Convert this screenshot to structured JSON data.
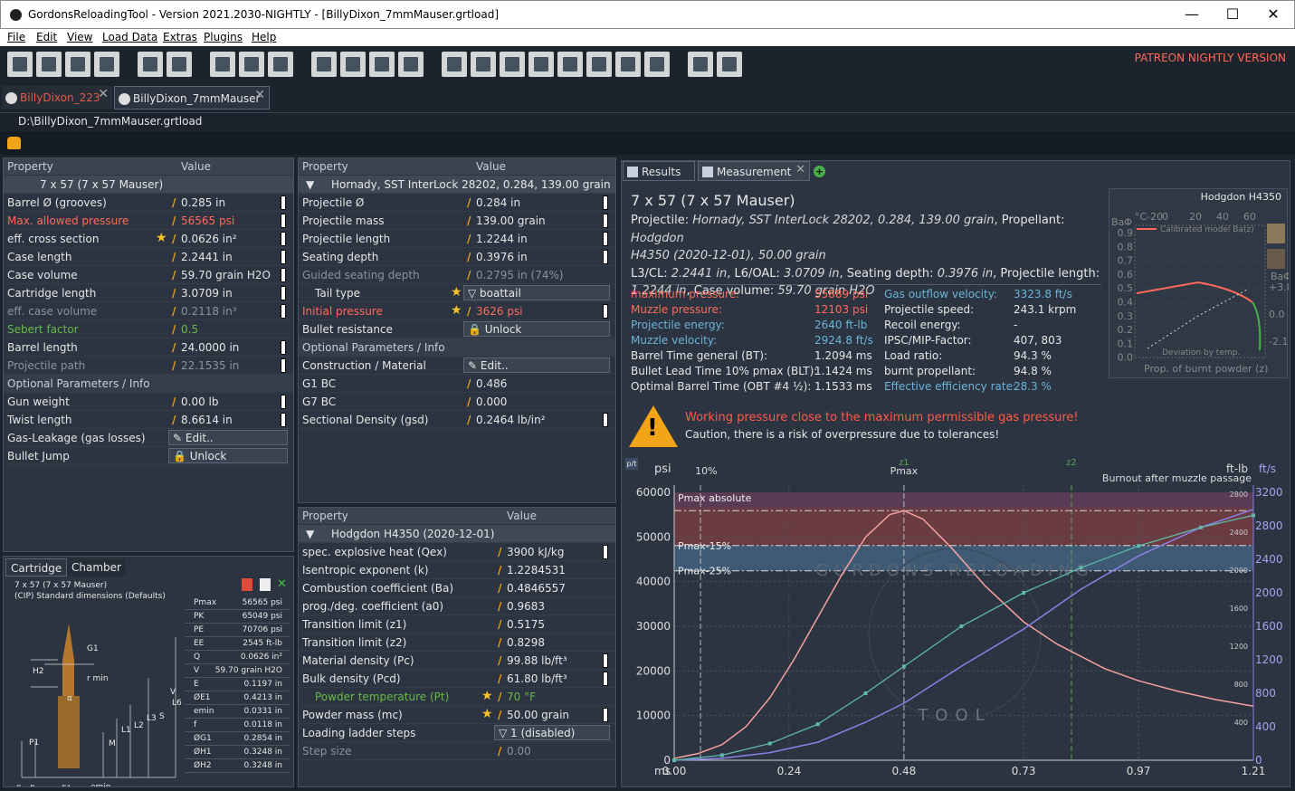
{
  "window": {
    "title": "GordonsReloadingTool - Version 2021.2030-NIGHTLY - [BillyDixon_7mmMauser.grtload]",
    "minimize": "—",
    "maximize": "☐",
    "close": "✕"
  },
  "menu": [
    "File",
    "Edit",
    "View",
    "Load Data",
    "Extras",
    "Plugins",
    "Help"
  ],
  "patreon": "PATREON NIGHTLY VERSION",
  "doc_tabs": [
    {
      "label": "BillyDixon_223"
    },
    {
      "label": "BillyDixon_7mmMauser"
    }
  ],
  "path": "D:\\BillyDixon_7mmMauser.grtload",
  "cartridge_panel": {
    "h_prop": "Property",
    "h_val": "Value",
    "group": "7 x 57 (7 x 57 Mauser)",
    "rows": [
      {
        "n": "Barrel Ø (grooves)",
        "v": "0.285 in"
      },
      {
        "n": "Max. allowed pressure",
        "v": "56565 psi"
      },
      {
        "n": "eff. cross section",
        "v": "0.0626 in²"
      },
      {
        "n": "Case length",
        "v": "2.2441 in"
      },
      {
        "n": "Case volume",
        "v": "59.70 grain H2O"
      },
      {
        "n": "Cartridge length",
        "v": "3.0709 in"
      },
      {
        "n": "eff. case volume",
        "v": "0.2118 in³"
      },
      {
        "n": "Sebert factor",
        "v": "0.5"
      },
      {
        "n": "Barrel length",
        "v": "24.0000 in"
      },
      {
        "n": "Projectile path",
        "v": "22.1535 in"
      }
    ],
    "opt": "Optional Parameters / Info",
    "rows2": [
      {
        "n": "Gun weight",
        "v": "0.00 lb"
      },
      {
        "n": "Twist length",
        "v": "8.6614 in"
      },
      {
        "n": "Gas-Leakage (gas losses)",
        "v": "Edit.."
      },
      {
        "n": "Bullet Jump",
        "v": "Unlock"
      }
    ]
  },
  "projectile_panel": {
    "h_prop": "Property",
    "h_val": "Value",
    "group": "Hornady, SST InterLock 28202, 0.284, 139.00 grain",
    "rows": [
      {
        "n": "Projectile Ø",
        "v": "0.284 in"
      },
      {
        "n": "Projectile mass",
        "v": "139.00 grain"
      },
      {
        "n": "Projectile length",
        "v": "1.2244 in"
      },
      {
        "n": "Seating depth",
        "v": "0.3976 in"
      },
      {
        "n": "Guided seating depth",
        "v": "0.2795 in (74%)"
      },
      {
        "n": "Tail type",
        "v": "boattail"
      },
      {
        "n": "Initial pressure",
        "v": "3626 psi"
      },
      {
        "n": "Bullet resistance",
        "v": "Unlock"
      }
    ],
    "opt": "Optional Parameters / Info",
    "rows2": [
      {
        "n": "Construction / Material",
        "v": "Edit.."
      },
      {
        "n": "G1 BC",
        "v": "0.486"
      },
      {
        "n": "G7 BC",
        "v": "0.000"
      },
      {
        "n": "Sectional Density (gsd)",
        "v": "0.2464 lb/in²"
      }
    ]
  },
  "powder_panel": {
    "h_prop": "Property",
    "h_val": "Value",
    "group": "Hodgdon H4350 (2020-12-01)",
    "rows": [
      {
        "n": "spec. explosive heat (Qex)",
        "v": "3900 kJ/kg"
      },
      {
        "n": "Isentropic exponent (k)",
        "v": "1.2284531"
      },
      {
        "n": "Combustion coefficient (Ba)",
        "v": "0.4846557"
      },
      {
        "n": "prog./deg. coefficient (a0)",
        "v": "0.9683"
      },
      {
        "n": "Transition limit (z1)",
        "v": "0.5175"
      },
      {
        "n": "Transition limit (z2)",
        "v": "0.8298"
      },
      {
        "n": "Material density (Pc)",
        "v": "99.88 lb/ft³"
      },
      {
        "n": "Bulk density (Pcd)",
        "v": "61.80 lb/ft³"
      },
      {
        "n": "Powder temperature (Pt)",
        "v": "70 °F"
      },
      {
        "n": "Powder mass (mc)",
        "v": "50.00 grain"
      },
      {
        "n": "Loading ladder steps",
        "v": "1 (disabled)"
      },
      {
        "n": "Step size",
        "v": "0.00"
      }
    ]
  },
  "cart_tabs": [
    "Cartridge",
    "Chamber"
  ],
  "cart_caption": [
    "7 x 57 (7 x 57 Mauser)",
    "(CIP) Standard dimensions (Defaults)"
  ],
  "cart_table": [
    [
      "Pmax",
      "56565 psi"
    ],
    [
      "PK",
      "65049 psi"
    ],
    [
      "PE",
      "70706 psi"
    ],
    [
      "EE",
      "2545 ft-lb"
    ],
    [
      "Q",
      "0.0626 in²"
    ],
    [
      "V",
      "59.70 grain H2O"
    ],
    [
      "E",
      "0.1197 in"
    ],
    [
      "ØE1",
      "0.4213 in"
    ],
    [
      "emin",
      "0.0331 in"
    ],
    [
      "f",
      "0.0118 in"
    ],
    [
      "ØG1",
      "0.2854 in"
    ],
    [
      "ØH1",
      "0.3248 in"
    ],
    [
      "ØH2",
      "0.3248 in"
    ]
  ],
  "cart_labels": {
    "g1": "G1",
    "h2": "H2",
    "rmin": "r min",
    "p1": "P1",
    "l1": "L1",
    "l2": "L2",
    "l3": "L3",
    "l6": "L6",
    "m": "M",
    "s": "S",
    "e": "E",
    "r": "R",
    "e1": "E1",
    "emin": "emin",
    "alpha": "α",
    "v": "V"
  },
  "results": {
    "tabs": [
      "Results",
      "Measurement"
    ],
    "title": "7 x 57 (7 x 57 Mauser)",
    "desc_lines": [
      {
        "k": "Projectile: ",
        "v": "Hornady, SST InterLock 28202, 0.284, 139.00 grain",
        "k2": ", Propellant: ",
        "v2": "Hodgdon"
      },
      {
        "v": "H4350 (2020-12-01), 50.00 grain"
      },
      {
        "k": "L3/CL: ",
        "v": "2.2441 in",
        "k2": ", L6/OAL: ",
        "v2": "3.0709 in",
        "k3": ", Seating depth: ",
        "v3": "0.3976 in",
        "k4": ", Projectile length:"
      },
      {
        "v": "1.2244 in",
        "k2": ", Case volume: ",
        "v2": "59.70 grain H2O"
      }
    ],
    "left": [
      {
        "k": "maximum pressure:",
        "v": "55889 psi",
        "c": "r"
      },
      {
        "k": "Muzzle pressure:",
        "v": "12103 psi",
        "c": "r"
      },
      {
        "k": "Projectile energy:",
        "v": "2640 ft-lb",
        "c": "c"
      },
      {
        "k": "Muzzle velocity:",
        "v": "2924.8 ft/s",
        "c": "c"
      },
      {
        "k": "Barrel Time general (BT):",
        "v": "1.2094 ms",
        "c": ""
      },
      {
        "k": "Bullet Lead Time 10% pmax (BLT):",
        "v": "1.1424 ms",
        "c": ""
      },
      {
        "k": "Optimal Barrel Time (OBT #4 ½):",
        "v": "1.1533 ms",
        "c": ""
      }
    ],
    "right": [
      {
        "k": "Gas outflow velocity:",
        "v": "3323.8 ft/s",
        "c": "c"
      },
      {
        "k": "Projectile speed:",
        "v": "243.1 krpm",
        "c": ""
      },
      {
        "k": "Recoil energy:",
        "v": "-",
        "c": ""
      },
      {
        "k": "IPSC/MIP-Factor:",
        "v": "407, 803",
        "c": ""
      },
      {
        "k": "Load ratio:",
        "v": "94.3 %",
        "c": ""
      },
      {
        "k": "burnt propellant:",
        "v": "94.8 %",
        "c": ""
      },
      {
        "k": "Effective efficiency rate:",
        "v": "28.3 %",
        "c": "c"
      }
    ],
    "warning_title": "Working pressure close to the maximum permissible gas pressure!",
    "warning_text": "Caution, there is a risk of overpressure due to tolerances!",
    "mini": {
      "title": "Hodgdon H4350",
      "xticks": [
        "°C-20",
        "0",
        "20",
        "40",
        "60"
      ],
      "legend": "Calibrated model Ba(z)",
      "ylabel": "BaΦ",
      "yticks": [
        "0.9",
        "0.8",
        "0.7",
        "0.6",
        "0.5",
        "0.4",
        "0.3",
        "0.2",
        "0.1",
        "0.0"
      ],
      "rticks": [
        "+3.8",
        "0.0",
        "-2.1"
      ],
      "rlabel": "BaΦ",
      "dev": "Deviation by temp.",
      "xlabel": "Prop. of burnt powder (z)"
    }
  },
  "chart_data": {
    "type": "line",
    "xlabel": "ms",
    "x_ticks": [
      "0.00",
      "0.24",
      "0.48",
      "0.73",
      "0.97",
      "1.21"
    ],
    "x_range": [
      0,
      1.21
    ],
    "y_left_label": "psi",
    "y_left_ticks": [
      0,
      10000,
      20000,
      30000,
      40000,
      50000,
      60000
    ],
    "y_right1_label": "ft-lb",
    "y_right1_ticks": [
      400,
      800,
      1200,
      1600,
      2000,
      2400,
      2800
    ],
    "y_right2_label": "ft/s",
    "y_right2_ticks": [
      0,
      400,
      800,
      1200,
      1600,
      2000,
      2400,
      2800,
      3200
    ],
    "annotations": {
      "p10": "10%",
      "z1": "z1",
      "pmax": "Pmax",
      "z2": "z2",
      "burnout": "Burnout after muzzle passage",
      "pmax_abs": "Pmax absolute",
      "pmax15": "Pmax-15%",
      "pmax25": "Pmax-25%"
    },
    "watermark_top": "GORDONS RELOADING",
    "watermark_bot": "TOOL",
    "series": [
      {
        "name": "pressure",
        "unit": "psi",
        "x": [
          0,
          0.05,
          0.1,
          0.15,
          0.2,
          0.25,
          0.3,
          0.35,
          0.4,
          0.45,
          0.48,
          0.52,
          0.58,
          0.65,
          0.73,
          0.8,
          0.9,
          0.97,
          1.05,
          1.13,
          1.21
        ],
        "y": [
          400,
          1500,
          3500,
          7500,
          14000,
          22500,
          32000,
          41500,
          50000,
          55000,
          55889,
          54000,
          47500,
          39000,
          31000,
          26000,
          20500,
          17800,
          15500,
          13600,
          12103
        ]
      },
      {
        "name": "energy",
        "unit": "ft-lb",
        "x": [
          0,
          0.1,
          0.2,
          0.3,
          0.4,
          0.48,
          0.6,
          0.73,
          0.85,
          0.97,
          1.1,
          1.21
        ],
        "y": [
          0,
          20,
          80,
          190,
          400,
          600,
          990,
          1380,
          1800,
          2150,
          2450,
          2640
        ]
      },
      {
        "name": "velocity",
        "unit": "ft/s",
        "x": [
          0,
          0.1,
          0.2,
          0.3,
          0.4,
          0.48,
          0.6,
          0.73,
          0.85,
          0.97,
          1.1,
          1.21
        ],
        "y": [
          0,
          60,
          200,
          430,
          800,
          1120,
          1600,
          2000,
          2300,
          2560,
          2780,
          2925
        ]
      }
    ]
  },
  "colors": {
    "pressure": "#f4a0a0",
    "energy": "#8a80e6",
    "velocity": "#5fb8a8",
    "accent": "#f2a417",
    "red": "#ff6a5a",
    "blue": "#6db4d8"
  }
}
